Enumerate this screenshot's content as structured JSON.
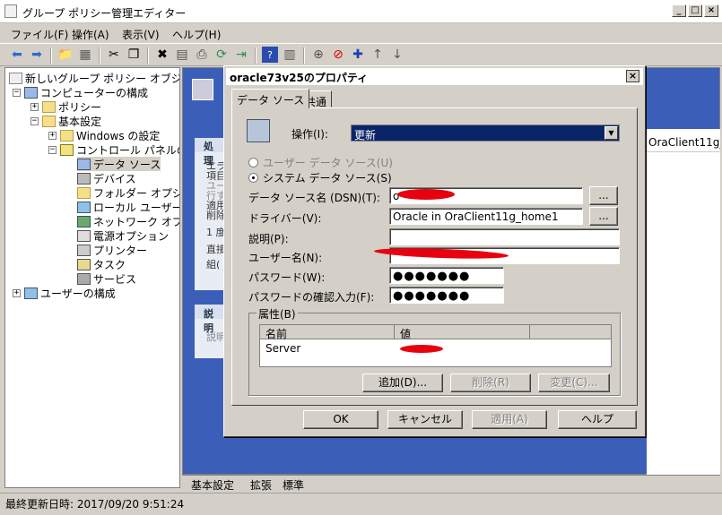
{
  "window": {
    "title": "グループ ポリシー管理エディター"
  },
  "menu": [
    "ファイル(F)",
    "操作(A)",
    "表示(V)",
    "ヘルプ(H)"
  ],
  "tree": {
    "root": "新しいグループ ポリシー オブジェクト",
    "computer_config": "コンピューターの構成",
    "policy": "ポリシー",
    "preferences": "基本設定",
    "windows_settings": "Windows の設定",
    "control_panel": "コントロール パネルの設",
    "children": [
      "データ ソース",
      "デバイス",
      "フォルダー オプション",
      "ローカル ユーザーと",
      "ネットワーク オプショ",
      "電源オプション",
      "プリンター",
      "タスク",
      "サービス"
    ],
    "user_config": "ユーザーの構成"
  },
  "right_pane": {
    "header": "処理",
    "column_header": "OraClient11g_",
    "lines": [
      "エラ",
      "項目",
      "ユー",
      "行す",
      "適用",
      "削除",
      "1 度",
      "直接",
      "組("
    ],
    "desc_header": "説明",
    "desc_text": "説明"
  },
  "bottom_tabs": [
    "基本設定",
    "拡張",
    "標準"
  ],
  "status": "最終更新日時: 2017/09/20 9:51:24",
  "dialog": {
    "title": "oracle73v25のプロパティ",
    "tabs": [
      "データ ソース",
      "共通"
    ],
    "action_label": "操作(I):",
    "action_value": "更新",
    "user_dsn_label": "ユーザー データ ソース(U)",
    "system_dsn_label": "システム データ ソース(S)",
    "dsn_label": "データ ソース名 (DSN)(T):",
    "dsn_value": "o",
    "driver_label": "ドライバー(V):",
    "driver_value": "Oracle in OraClient11g_home1",
    "desc_label": "説明(P):",
    "user_label": "ユーザー名(N):",
    "password_label": "パスワード(W):",
    "password_value": "●●●●●●●",
    "password_confirm_label": "パスワードの確認入力(F):",
    "password_confirm_value": "●●●●●●●",
    "browse": "...",
    "attributes_label": "属性(B)",
    "attr_col_name": "名前",
    "attr_col_value": "値",
    "attr_row_name": "Server",
    "add_button": "追加(D)...",
    "delete_button": "削除(R)",
    "change_button": "変更(C)...",
    "ok": "OK",
    "cancel": "キャンセル",
    "apply": "適用(A)",
    "help": "ヘルプ"
  }
}
